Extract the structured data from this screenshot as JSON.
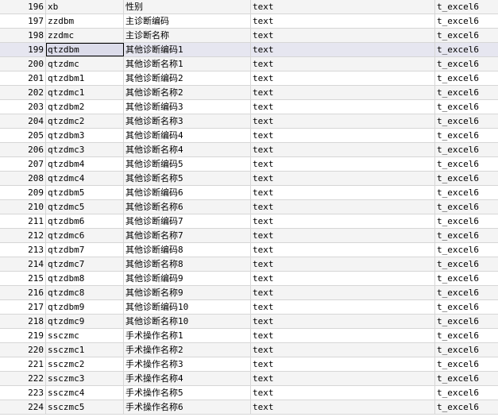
{
  "rows": [
    {
      "num": "196",
      "field": "xb",
      "label": "性别",
      "type": "text",
      "table": "t_excel6"
    },
    {
      "num": "197",
      "field": "zzdbm",
      "label": "主诊断编码",
      "type": "text",
      "table": "t_excel6"
    },
    {
      "num": "198",
      "field": "zzdmc",
      "label": "主诊断名称",
      "type": "text",
      "table": "t_excel6"
    },
    {
      "num": "199",
      "field": "qtzdbm",
      "label": "其他诊断编码1",
      "type": "text",
      "table": "t_excel6"
    },
    {
      "num": "200",
      "field": "qtzdmc",
      "label": "其他诊断名称1",
      "type": "text",
      "table": "t_excel6"
    },
    {
      "num": "201",
      "field": "qtzdbm1",
      "label": "其他诊断编码2",
      "type": "text",
      "table": "t_excel6"
    },
    {
      "num": "202",
      "field": "qtzdmc1",
      "label": "其他诊断名称2",
      "type": "text",
      "table": "t_excel6"
    },
    {
      "num": "203",
      "field": "qtzdbm2",
      "label": "其他诊断编码3",
      "type": "text",
      "table": "t_excel6"
    },
    {
      "num": "204",
      "field": "qtzdmc2",
      "label": "其他诊断名称3",
      "type": "text",
      "table": "t_excel6"
    },
    {
      "num": "205",
      "field": "qtzdbm3",
      "label": "其他诊断编码4",
      "type": "text",
      "table": "t_excel6"
    },
    {
      "num": "206",
      "field": "qtzdmc3",
      "label": "其他诊断名称4",
      "type": "text",
      "table": "t_excel6"
    },
    {
      "num": "207",
      "field": "qtzdbm4",
      "label": "其他诊断编码5",
      "type": "text",
      "table": "t_excel6"
    },
    {
      "num": "208",
      "field": "qtzdmc4",
      "label": "其他诊断名称5",
      "type": "text",
      "table": "t_excel6"
    },
    {
      "num": "209",
      "field": "qtzdbm5",
      "label": "其他诊断编码6",
      "type": "text",
      "table": "t_excel6"
    },
    {
      "num": "210",
      "field": "qtzdmc5",
      "label": "其他诊断名称6",
      "type": "text",
      "table": "t_excel6"
    },
    {
      "num": "211",
      "field": "qtzdbm6",
      "label": "其他诊断编码7",
      "type": "text",
      "table": "t_excel6"
    },
    {
      "num": "212",
      "field": "qtzdmc6",
      "label": "其他诊断名称7",
      "type": "text",
      "table": "t_excel6"
    },
    {
      "num": "213",
      "field": "qtzdbm7",
      "label": "其他诊断编码8",
      "type": "text",
      "table": "t_excel6"
    },
    {
      "num": "214",
      "field": "qtzdmc7",
      "label": "其他诊断名称8",
      "type": "text",
      "table": "t_excel6"
    },
    {
      "num": "215",
      "field": "qtzdbm8",
      "label": "其他诊断编码9",
      "type": "text",
      "table": "t_excel6"
    },
    {
      "num": "216",
      "field": "qtzdmc8",
      "label": "其他诊断名称9",
      "type": "text",
      "table": "t_excel6"
    },
    {
      "num": "217",
      "field": "qtzdbm9",
      "label": "其他诊断编码10",
      "type": "text",
      "table": "t_excel6"
    },
    {
      "num": "218",
      "field": "qtzdmc9",
      "label": "其他诊断名称10",
      "type": "text",
      "table": "t_excel6"
    },
    {
      "num": "219",
      "field": "ssczmc",
      "label": "手术操作名称1",
      "type": "text",
      "table": "t_excel6"
    },
    {
      "num": "220",
      "field": "ssczmc1",
      "label": "手术操作名称2",
      "type": "text",
      "table": "t_excel6"
    },
    {
      "num": "221",
      "field": "ssczmc2",
      "label": "手术操作名称3",
      "type": "text",
      "table": "t_excel6"
    },
    {
      "num": "222",
      "field": "ssczmc3",
      "label": "手术操作名称4",
      "type": "text",
      "table": "t_excel6"
    },
    {
      "num": "223",
      "field": "ssczmc4",
      "label": "手术操作名称5",
      "type": "text",
      "table": "t_excel6"
    },
    {
      "num": "224",
      "field": "ssczmc5",
      "label": "手术操作名称6",
      "type": "text",
      "table": "t_excel6"
    }
  ],
  "selected_row_index": 3,
  "colors": {
    "grid_line": "#d6d6d6",
    "alt_row": "#f4f4f4",
    "selected_row": "#e6e6f0"
  }
}
